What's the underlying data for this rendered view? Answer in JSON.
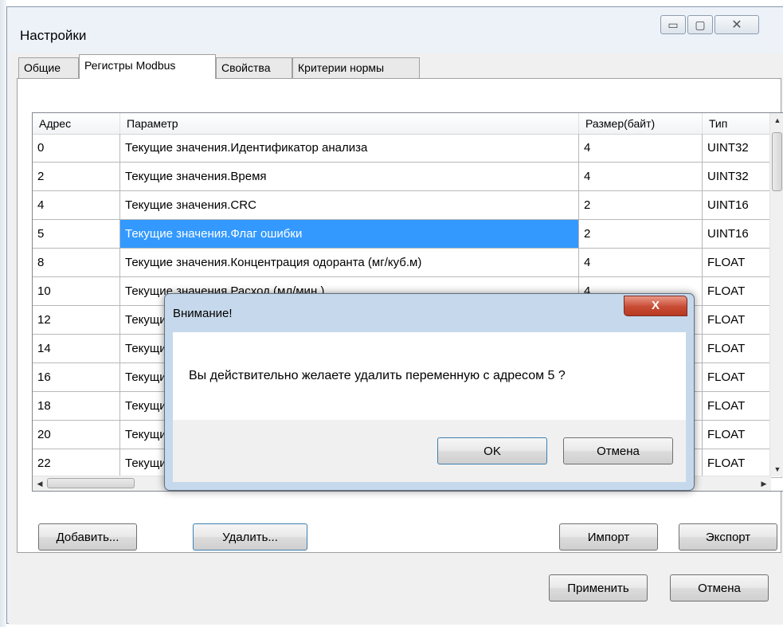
{
  "window": {
    "title": "Настройки",
    "minimize_glyph": "▭",
    "maximize_glyph": "▢",
    "close_glyph": "✕"
  },
  "tabs": [
    "Общие",
    "Регистры Modbus",
    "Свойства",
    "Критерии нормы"
  ],
  "grid": {
    "columns": [
      "Адрес",
      "Параметр",
      "Размер(байт)",
      "Тип"
    ],
    "rows": [
      [
        "0",
        "Текущие значения.Идентификатор анализа",
        "4",
        "UINT32"
      ],
      [
        "2",
        "Текущие значения.Время",
        "4",
        "UINT32"
      ],
      [
        "4",
        "Текущие значения.CRC",
        "2",
        "UINT16"
      ],
      [
        "5",
        "Текущие значения.Флаг ошибки",
        "2",
        "UINT16"
      ],
      [
        "8",
        "Текущие значения.Концентрация одоранта (мг/куб.м)",
        "4",
        "FLOAT"
      ],
      [
        "10",
        "Текущие значения.Расход (мл/мин.)",
        "4",
        "FLOAT"
      ],
      [
        "12",
        "Текущие значения",
        "",
        "FLOAT"
      ],
      [
        "14",
        "Текущие значения",
        "",
        "FLOAT"
      ],
      [
        "16",
        "Текущие значения",
        "",
        "FLOAT"
      ],
      [
        "18",
        "Текущие значения",
        "",
        "FLOAT"
      ],
      [
        "20",
        "Текущие значения",
        "",
        "FLOAT"
      ],
      [
        "22",
        "Текущие значения",
        "",
        "FLOAT"
      ]
    ],
    "selected_row": 3
  },
  "buttons": {
    "add": "Добавить...",
    "delete": "Удалить...",
    "import": "Импорт",
    "export": "Экспорт",
    "apply": "Применить",
    "cancel": "Отмена"
  },
  "dialog": {
    "title": "Внимание!",
    "message": "Вы действительно желаете удалить переменную с адресом 5 ?",
    "close_glyph": "X",
    "ok": "OK",
    "cancel": "Отмена"
  }
}
